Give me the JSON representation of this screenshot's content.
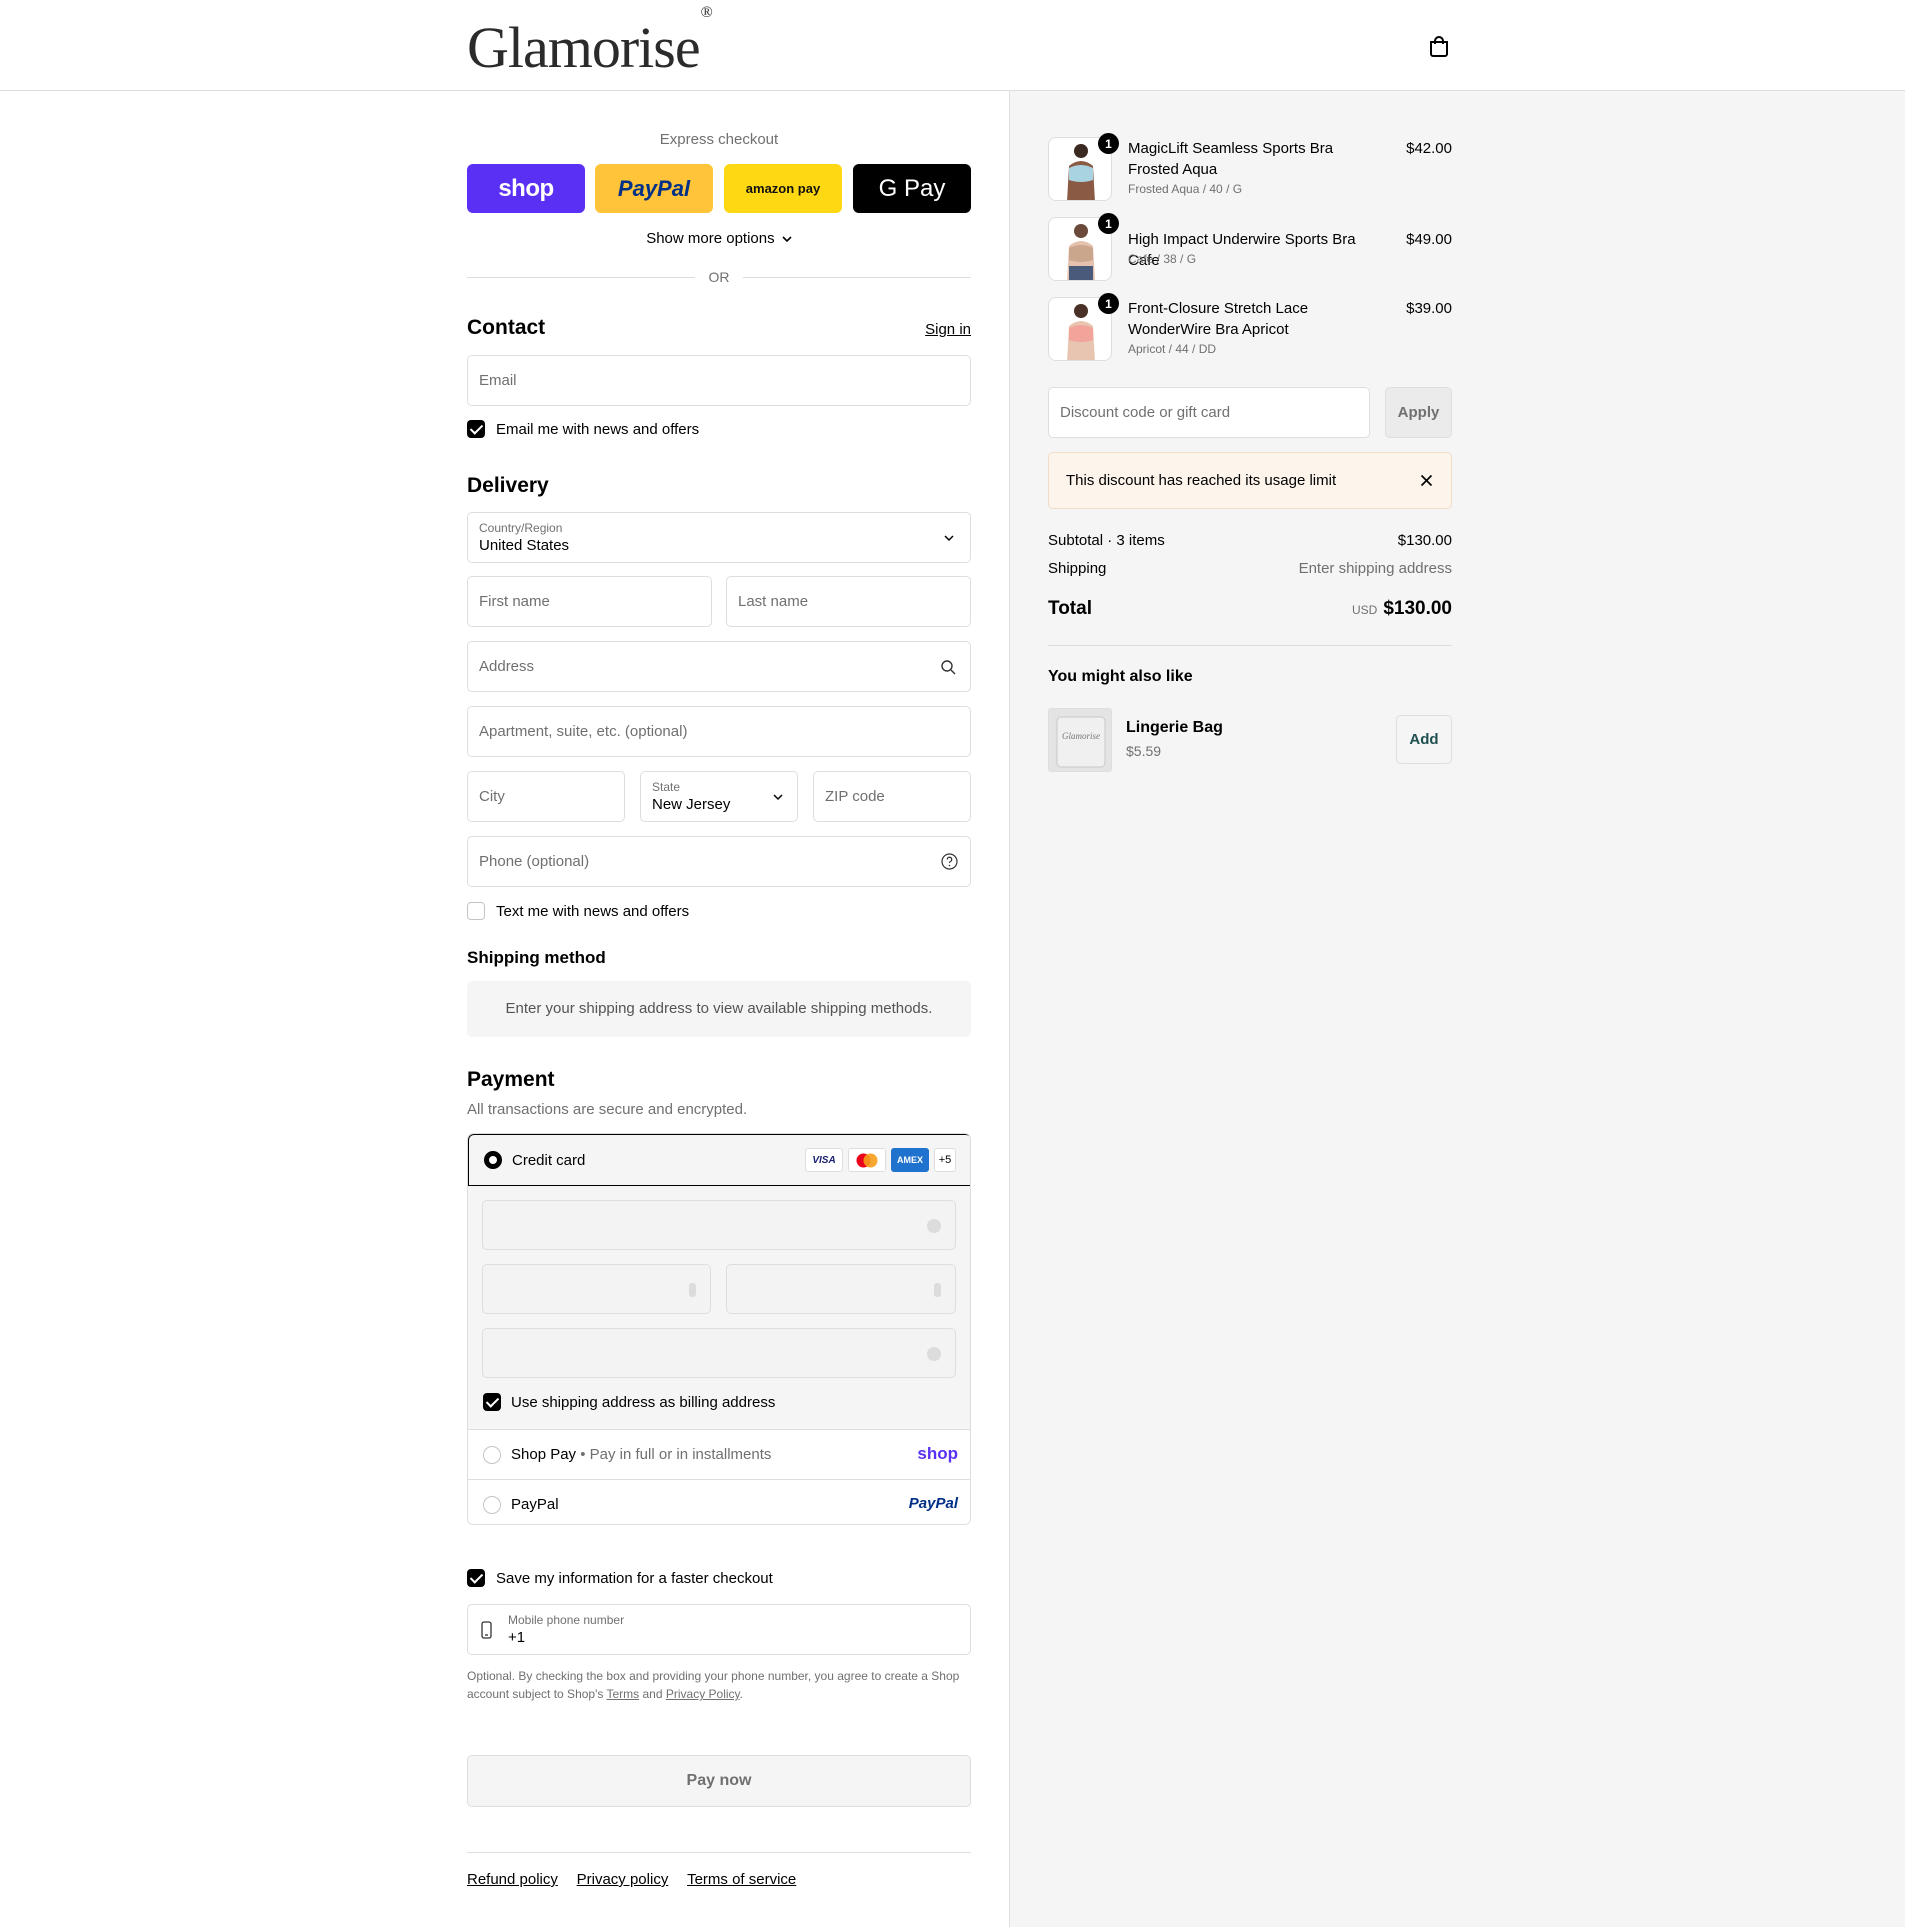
{
  "header": {
    "logo": "Glamorise",
    "logo_mark": "®",
    "bag_icon": "shopping-bag-icon"
  },
  "express": {
    "title": "Express checkout",
    "buttons": [
      {
        "name": "shop",
        "label": "shop",
        "bg": "#5a31f4",
        "fg": "#ffffff"
      },
      {
        "name": "paypal",
        "label": "PayPal",
        "bg": "#ffc439",
        "fg": "#003087"
      },
      {
        "name": "amazon",
        "label": "amazon pay",
        "bg": "#ffd814",
        "fg": "#111111"
      },
      {
        "name": "gpay",
        "label": "G Pay",
        "bg": "#000000",
        "fg": "#ffffff"
      }
    ],
    "show_more": "Show more options",
    "or": "OR"
  },
  "contact": {
    "title": "Contact",
    "sign_in": "Sign in",
    "email_placeholder": "Email",
    "news_label": "Email me with news and offers",
    "news_checked": true
  },
  "delivery": {
    "title": "Delivery",
    "country_label": "Country/Region",
    "country_value": "United States",
    "first_name": "First name",
    "last_name": "Last name",
    "address": "Address",
    "apartment": "Apartment, suite, etc. (optional)",
    "city": "City",
    "state_label": "State",
    "state_value": "New Jersey",
    "zip": "ZIP code",
    "phone": "Phone (optional)",
    "text_label": "Text me with news and offers",
    "text_checked": false
  },
  "shipping_method": {
    "title": "Shipping method",
    "message": "Enter your shipping address to view available shipping methods."
  },
  "payment": {
    "title": "Payment",
    "subtitle": "All transactions are secure and encrypted.",
    "credit_card": "Credit card",
    "card_logos": [
      "VISA",
      "MC",
      "AMEX",
      "+5"
    ],
    "billing_same": "Use shipping address as billing address",
    "shop_pay": "Shop Pay",
    "shop_pay_desc": "Pay in full or in installments",
    "shop_pay_logo": "shop",
    "paypal": "PayPal",
    "paypal_logo": "PayPal"
  },
  "remember": {
    "label": "Save my information for a faster checkout",
    "checked": true,
    "mobile_label": "Mobile phone number",
    "mobile_value": "+1",
    "legal_1": "Optional. By checking the box and providing your phone number, you agree to create a Shop account subject to Shop's ",
    "terms": "Terms",
    "and": " and ",
    "privacy": "Privacy Policy",
    "period": "."
  },
  "pay_now": "Pay now",
  "footer": {
    "refund": "Refund policy",
    "privacy": "Privacy policy",
    "terms": "Terms of service"
  },
  "cart": {
    "items": [
      {
        "name": "MagicLift Seamless Sports Bra Frosted Aqua",
        "variant": "Frosted Aqua / 40 / G",
        "price": "$42.00",
        "qty": "1",
        "color": "#a9d3e0"
      },
      {
        "name": "High Impact Underwire Sports Bra Cafe",
        "variant": "Cafe / 38 / G",
        "price": "$49.00",
        "qty": "1",
        "color": "#c9a68c"
      },
      {
        "name": "Front-Closure Stretch Lace WonderWire Bra Apricot",
        "variant": "Apricot / 44 / DD",
        "price": "$39.00",
        "qty": "1",
        "color": "#f2a49b"
      }
    ],
    "discount_placeholder": "Discount code or gift card",
    "apply": "Apply",
    "alert": "This discount has reached its usage limit",
    "subtotal_label": "Subtotal · 3 items",
    "subtotal_value": "$130.00",
    "shipping_label": "Shipping",
    "shipping_value": "Enter shipping address",
    "total_label": "Total",
    "currency": "USD",
    "total_value": "$130.00"
  },
  "upsell": {
    "title": "You might also like",
    "name": "Lingerie Bag",
    "price": "$5.59",
    "add": "Add",
    "logo": "Glamorise"
  }
}
